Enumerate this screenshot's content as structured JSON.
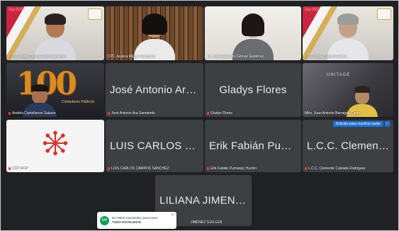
{
  "tiles": [
    {
      "id": "oscar-espinosa",
      "type": "video",
      "name": "C.P.C. Oscar Osuna Espinosa Arceo",
      "brand": "Soy RCP"
    },
    {
      "id": "jessica-miguel",
      "type": "video",
      "name": "CPC Jessica Miguel Sandoval"
    },
    {
      "id": "alejandra-gomez",
      "type": "video",
      "name": "Lic. Itzia Alejandra Gómez Gutiérrez"
    },
    {
      "id": "oscar-castillo",
      "type": "video",
      "name": "CPC Oscar Castillo García",
      "brand": "Soy RCP"
    },
    {
      "id": "andres-castellanos",
      "type": "video",
      "name": "Andrés Castellanos Salazar",
      "logo_text": "100",
      "logo_sub": "Contadores Públicos"
    },
    {
      "id": "jose-antonio",
      "type": "name",
      "big": "José Antonio Ara...",
      "name": "José Antonio Ara Sarmiento"
    },
    {
      "id": "gladys-flores",
      "type": "name",
      "big": "Gladys Flores",
      "name": "Gladys Flores"
    },
    {
      "id": "juan-barragan",
      "type": "video",
      "name": "Mtro. Juan Antonio Barragán Castel",
      "sign": "UNITAGE"
    },
    {
      "id": "ccp-rcp",
      "type": "logo",
      "name": "CCP RCP"
    },
    {
      "id": "luis-carlos",
      "type": "name",
      "big": "LUIS CARLOS CA...",
      "name": "LUIS CARLOS CAMPOS SANCHEZ"
    },
    {
      "id": "erik-fabian",
      "type": "name",
      "big": "Erik Fabián Pumar...",
      "name": "Erik Fabián Pumarejo Huchin"
    },
    {
      "id": "clemente",
      "type": "name",
      "big": "L.C.C. Clemente C...",
      "name": "L.C.C. Clemente Calzada Rodriguez"
    },
    {
      "id": "liliana",
      "type": "name",
      "big": "LILIANA JIMENEZ...",
      "name": "JIMENEZ GUILLEN"
    }
  ],
  "overlay": {
    "request_label": "Solicitar para reactivar audio",
    "more_symbol": "···"
  },
  "chat": {
    "avatar": "MH",
    "line1": "De María Hernández para todos",
    "line2": "TODO EXCELENTE",
    "close": "×"
  },
  "colors": {
    "accent": "#8ab4f8",
    "mic_off": "#ea4335",
    "tile_bg": "#3c4043",
    "page_bg": "#202124"
  }
}
